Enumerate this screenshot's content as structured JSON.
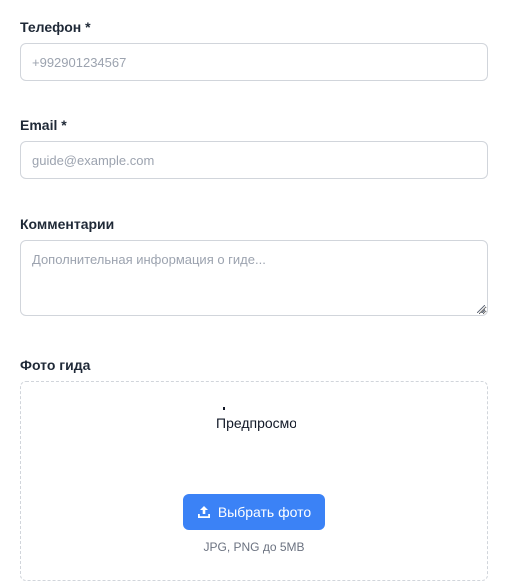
{
  "phone": {
    "label": "Телефон *",
    "placeholder": "+992901234567",
    "value": ""
  },
  "email": {
    "label": "Email *",
    "placeholder": "guide@example.com",
    "value": ""
  },
  "comments": {
    "label": "Комментарии",
    "placeholder": "Дополнительная информация о гиде...",
    "value": ""
  },
  "photo": {
    "label": "Фото гида",
    "preview_alt": "Предпросмотр",
    "upload_button_label": "Выбрать фото",
    "upload_icon": "upload-icon",
    "hint": "JPG, PNG до 5MB"
  },
  "colors": {
    "accent": "#3b82f6",
    "border": "#d1d5db",
    "placeholder": "#9ca3af",
    "label": "#1f2937",
    "hint": "#6b7280"
  }
}
